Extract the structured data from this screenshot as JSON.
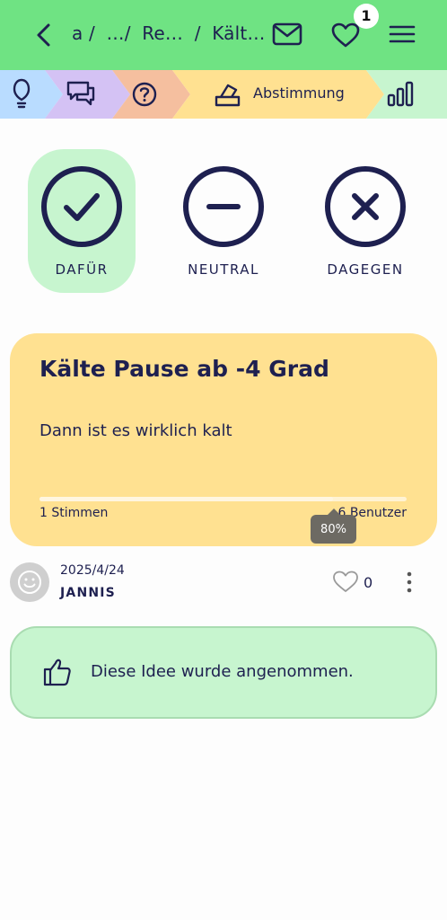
{
  "header": {
    "breadcrumbs": [
      "a /",
      "…/",
      "Re…",
      "/",
      "Kält…"
    ],
    "notification_count": "1",
    "colors": {
      "bar": "#6fe383"
    }
  },
  "phases": {
    "items": [
      {
        "icon": "lightbulb-icon",
        "color": "#b9dcff"
      },
      {
        "icon": "discussion-icon",
        "color": "#d4c2f4"
      },
      {
        "icon": "question-icon",
        "color": "#f5bf9f"
      },
      {
        "icon": "ballot-box-icon",
        "color": "#ffe191",
        "label": "Abstimmung",
        "active": true
      },
      {
        "icon": "results-chart-icon",
        "color": "#c7f5cf"
      }
    ]
  },
  "vote_options": [
    {
      "label": "DAFÜR",
      "icon": "check-circle-icon",
      "selected": true
    },
    {
      "label": "NEUTRAL",
      "icon": "minus-circle-icon",
      "selected": false
    },
    {
      "label": "DAGEGEN",
      "icon": "x-circle-icon",
      "selected": false
    }
  ],
  "idea": {
    "title": "Kälte Pause ab -4 Grad",
    "description": "Dann ist es wirklich kalt",
    "votes_text": "1 Stimmen",
    "users_text": "6 Benutzer",
    "progress_percent": 80,
    "progress_tooltip": "80%"
  },
  "meta": {
    "date": "2025/4/24",
    "author": "JANNIS",
    "like_count": "0"
  },
  "status": {
    "text": "Diese Idee wurde angenommen.",
    "icon": "thumbs-up-icon"
  }
}
